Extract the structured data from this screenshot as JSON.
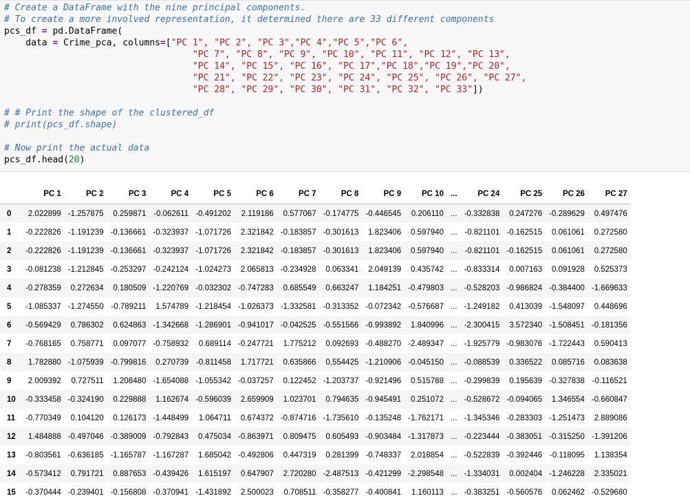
{
  "code": {
    "comment1": "# Create a DataFrame with the nine principal components.",
    "comment2": "# To create a more involved representation, it determined there are 33 different components",
    "line3_var": "pcs_df",
    "line3_eq": " = ",
    "line3_call": "pd.DataFrame(",
    "line4_indent": "    data ",
    "line4_eq": "=",
    "line4_mid": " Crime_pca, columns",
    "line4_eq2": "=",
    "line4_bracket": "[",
    "line4_cols": "\"PC 1\", \"PC 2\", \"PC 3\",\"PC 4\",\"PC 5\",\"PC 6\",",
    "line5_cols": "\"PC 7\", \"PC 8\", \"PC 9\", \"PC 10\", \"PC 11\", \"PC 12\", \"PC 13\",",
    "line6_cols": "\"PC 14\", \"PC 15\", \"PC 16\", \"PC 17\",\"PC 18\",\"PC 19\",\"PC 20\",",
    "line7_cols": "\"PC 21\", \"PC 22\", \"PC 23\", \"PC 24\", \"PC 25\", \"PC 26\", \"PC 27\",",
    "line8_cols": "\"PC 28\", \"PC 29\", \"PC 30\", \"PC 31\", \"PC 32\", \"PC 33\"",
    "line8_end": "])",
    "comment3": "# # Print the shape of the clustered_df",
    "comment4": "# print(pcs_df.shape)",
    "comment5": "# Now print the actual data",
    "last_call": "pcs_df.head(",
    "last_num": "20",
    "last_close": ")"
  },
  "table": {
    "columns": [
      "PC 1",
      "PC 2",
      "PC 3",
      "PC 4",
      "PC 5",
      "PC 6",
      "PC 7",
      "PC 8",
      "PC 9",
      "PC 10",
      "...",
      "PC 24",
      "PC 25",
      "PC 26",
      "PC 27"
    ],
    "rows": [
      {
        "idx": "0",
        "cells": [
          "2.022899",
          "-1.257875",
          "0.259871",
          "-0.062611",
          "-0.491202",
          "2.119186",
          "0.577067",
          "-0.174775",
          "-0.446545",
          "0.206110",
          "...",
          "-0.332838",
          "0.247276",
          "-0.289629",
          "0.497476"
        ]
      },
      {
        "idx": "1",
        "cells": [
          "-0.222826",
          "-1.191239",
          "-0.136661",
          "-0.323937",
          "-1.071726",
          "2.321842",
          "-0.183857",
          "-0.301613",
          "1.823406",
          "0.597940",
          "...",
          "-0.821101",
          "-0.162515",
          "0.061061",
          "0.272580"
        ]
      },
      {
        "idx": "2",
        "cells": [
          "-0.222826",
          "-1.191239",
          "-0.136661",
          "-0.323937",
          "-1.071726",
          "2.321842",
          "-0.183857",
          "-0.301613",
          "1.823406",
          "0.597940",
          "...",
          "-0.821101",
          "-0.162515",
          "0.061061",
          "0.272580"
        ]
      },
      {
        "idx": "3",
        "cells": [
          "-0.081238",
          "-1.212845",
          "-0.253297",
          "-0.242124",
          "-1.024273",
          "2.065813",
          "-0.234928",
          "0.063341",
          "2.049139",
          "0.435742",
          "...",
          "-0.833314",
          "0.007163",
          "0.091928",
          "0.525373"
        ]
      },
      {
        "idx": "4",
        "cells": [
          "-0.278359",
          "0.272634",
          "0.180509",
          "-1.220769",
          "-0.032302",
          "-0.747283",
          "0.685549",
          "0.663247",
          "1.184251",
          "-0.479803",
          "...",
          "-0.528203",
          "-0.986824",
          "-0.384400",
          "-1.669633"
        ]
      },
      {
        "idx": "5",
        "cells": [
          "-1.085337",
          "-1.274550",
          "-0.789211",
          "1.574789",
          "-1.218454",
          "-1.026373",
          "-1.332581",
          "-0.313352",
          "-0.072342",
          "-0.576687",
          "...",
          "-1.249182",
          "0.413039",
          "-1.548097",
          "0.448696"
        ]
      },
      {
        "idx": "6",
        "cells": [
          "-0.569429",
          "0.786302",
          "0.624863",
          "-1.342668",
          "-1.286901",
          "-0.941017",
          "-0.042525",
          "-0.551566",
          "-0.993892",
          "1.840996",
          "...",
          "-2.300415",
          "3.572340",
          "-1.508451",
          "-0.181356"
        ]
      },
      {
        "idx": "7",
        "cells": [
          "-0.768165",
          "0.758771",
          "0.097077",
          "-0.758932",
          "0.689114",
          "-0.247721",
          "1.775212",
          "0.092693",
          "-0.488270",
          "-2.489347",
          "...",
          "-1.925779",
          "-0.983076",
          "-1.722443",
          "0.590413"
        ]
      },
      {
        "idx": "8",
        "cells": [
          "1.782880",
          "-1.075939",
          "-0.799816",
          "0.270739",
          "-0.811458",
          "1.717721",
          "0.635866",
          "0.554425",
          "-1.210906",
          "-0.045150",
          "...",
          "-0.088539",
          "0.336522",
          "0.085716",
          "0.083638"
        ]
      },
      {
        "idx": "9",
        "cells": [
          "2.009392",
          "0.727511",
          "1.208480",
          "-1.654088",
          "-1.055342",
          "-0.037257",
          "0.122452",
          "-1.203737",
          "-0.921496",
          "0.515788",
          "...",
          "-0.299839",
          "0.195639",
          "-0.327838",
          "-0.116521"
        ]
      },
      {
        "idx": "10",
        "cells": [
          "-0.333458",
          "-0.324190",
          "0.229888",
          "1.162674",
          "-0.596039",
          "2.659909",
          "1.023701",
          "0.794635",
          "-0.945491",
          "0.251072",
          "...",
          "-0.528672",
          "-0.094065",
          "1.346554",
          "-0.660847"
        ]
      },
      {
        "idx": "11",
        "cells": [
          "-0.770349",
          "0.104120",
          "0.126173",
          "-1.448499",
          "1.064711",
          "0.674372",
          "-0.874716",
          "-1.735610",
          "-0.135248",
          "-1.762171",
          "...",
          "-1.345346",
          "-0.283303",
          "-1.251473",
          "2.889086"
        ]
      },
      {
        "idx": "12",
        "cells": [
          "1.484888",
          "-0.497046",
          "-0.389009",
          "-0.792843",
          "0.475034",
          "-0.863971",
          "0.809475",
          "0.605493",
          "-0.903484",
          "-1.317873",
          "...",
          "-0.223444",
          "-0.383051",
          "-0.315250",
          "-1.391206"
        ]
      },
      {
        "idx": "13",
        "cells": [
          "-0.803561",
          "-0.636185",
          "-1.165787",
          "-1.167287",
          "1.685042",
          "-0.492806",
          "0.447319",
          "0.281399",
          "-0.748337",
          "2.018854",
          "...",
          "-0.522839",
          "-0.392446",
          "-0.118095",
          "1.138354"
        ]
      },
      {
        "idx": "14",
        "cells": [
          "-0.573412",
          "0.791721",
          "0.887653",
          "-0.439426",
          "1.615197",
          "0.647907",
          "2.720280",
          "-2.487513",
          "-0.421299",
          "-2.298548",
          "...",
          "-1.334031",
          "0.002404",
          "-1.246228",
          "2.335021"
        ]
      },
      {
        "idx": "15",
        "cells": [
          "-0.370444",
          "-0.239401",
          "-0.156808",
          "-0.370941",
          "-1.431892",
          "2.500023",
          "0.708511",
          "-0.358277",
          "-0.400841",
          "1.160113",
          "...",
          "-0.383251",
          "-0.560576",
          "0.062462",
          "-0.529680"
        ]
      }
    ]
  }
}
